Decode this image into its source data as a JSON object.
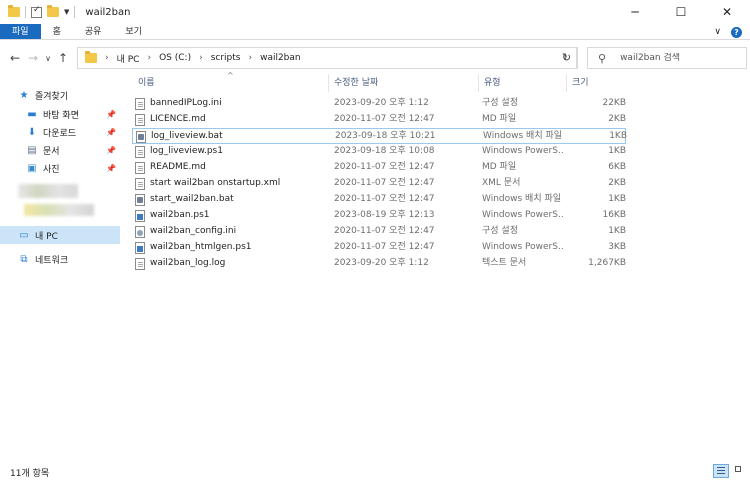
{
  "window": {
    "title": "wail2ban",
    "minimize": "─",
    "maximize": "☐",
    "close": "✕"
  },
  "ribbon": {
    "tabs": [
      "파일",
      "홈",
      "공유",
      "보기"
    ],
    "expand": "∨",
    "help": "?"
  },
  "nav": {
    "back": "←",
    "forward": "→",
    "recent": "∨",
    "up": "↑",
    "breadcrumb": [
      "내 PC",
      "OS (C:)",
      "scripts",
      "wail2ban"
    ],
    "refresh": "↻",
    "search_placeholder": "wail2ban 검색"
  },
  "sidebar": {
    "quick_access": "즐겨찾기",
    "items": [
      {
        "label": "바탕 화면",
        "icon": "desktop-icon"
      },
      {
        "label": "다운로드",
        "icon": "download-icon"
      },
      {
        "label": "문서",
        "icon": "document-icon"
      },
      {
        "label": "사진",
        "icon": "picture-icon"
      }
    ],
    "this_pc": "내 PC",
    "network": "네트워크"
  },
  "columns": {
    "name": "이름",
    "date": "수정한 날짜",
    "type": "유형",
    "size": "크기"
  },
  "files": [
    {
      "name": "bannedIPLog.ini",
      "date": "2023-09-20 오후 1:12",
      "type": "구성 설정",
      "size": "22KB",
      "icon": "doc"
    },
    {
      "name": "LICENCE.md",
      "date": "2020-11-07 오전 12:47",
      "type": "MD 파일",
      "size": "2KB",
      "icon": "doc"
    },
    {
      "name": "log_liveview.bat",
      "date": "2023-09-18 오후 10:21",
      "type": "Windows 배치 파일",
      "size": "1KB",
      "icon": "bat"
    },
    {
      "name": "log_liveview.ps1",
      "date": "2023-09-18 오후 10:08",
      "type": "Windows PowerS...",
      "size": "1KB",
      "icon": "doc"
    },
    {
      "name": "README.md",
      "date": "2020-11-07 오전 12:47",
      "type": "MD 파일",
      "size": "6KB",
      "icon": "doc"
    },
    {
      "name": "start wail2ban onstartup.xml",
      "date": "2020-11-07 오전 12:47",
      "type": "XML 문서",
      "size": "2KB",
      "icon": "doc"
    },
    {
      "name": "start_wail2ban.bat",
      "date": "2020-11-07 오전 12:47",
      "type": "Windows 배치 파일",
      "size": "1KB",
      "icon": "bat"
    },
    {
      "name": "wail2ban.ps1",
      "date": "2023-08-19 오후 12:13",
      "type": "Windows PowerS...",
      "size": "16KB",
      "icon": "ps"
    },
    {
      "name": "wail2ban_config.ini",
      "date": "2020-11-07 오전 12:47",
      "type": "구성 설정",
      "size": "1KB",
      "icon": "cfg"
    },
    {
      "name": "wail2ban_htmlgen.ps1",
      "date": "2020-11-07 오전 12:47",
      "type": "Windows PowerS...",
      "size": "3KB",
      "icon": "ps"
    },
    {
      "name": "wail2ban_log.log",
      "date": "2023-09-20 오후 1:12",
      "type": "텍스트 문서",
      "size": "1,267KB",
      "icon": "doc"
    }
  ],
  "status": {
    "item_count": "11개 항목"
  }
}
